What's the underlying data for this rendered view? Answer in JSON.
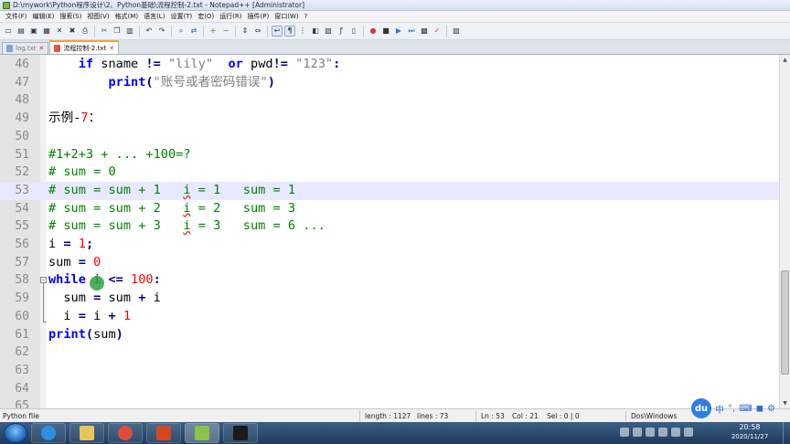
{
  "window": {
    "title": "D:\\mywork\\Python程序设计\\2、Python基础\\流程控制-2.txt - Notepad++ [Administrator]"
  },
  "menu": [
    "文件(F)",
    "编辑(E)",
    "搜索(S)",
    "视图(V)",
    "格式(M)",
    "语言(L)",
    "设置(T)",
    "宏(O)",
    "运行(R)",
    "插件(P)",
    "窗口(W)",
    "?"
  ],
  "toolbar_icons": [
    "new-file-icon",
    "open-file-icon",
    "save-icon",
    "save-all-icon",
    "close-icon",
    "close-all-icon",
    "print-icon",
    "cut-icon",
    "copy-icon",
    "paste-icon",
    "undo-icon",
    "redo-icon",
    "find-icon",
    "replace-icon",
    "zoom-in-icon",
    "zoom-out-icon",
    "sync-v-icon",
    "sync-h-icon",
    "word-wrap-icon",
    "show-all-chars-icon",
    "indent-guide-icon",
    "user-lang-icon",
    "doc-map-icon",
    "function-list-icon",
    "folder-workspace-icon",
    "record-macro-icon",
    "stop-record-icon",
    "play-macro-icon",
    "play-multiple-icon",
    "save-macro-icon",
    "spell-check-icon",
    "doc-switcher-icon"
  ],
  "tabs": [
    {
      "label": "log.txt",
      "active": false
    },
    {
      "label": "流程控制-2.txt",
      "active": true
    }
  ],
  "editor": {
    "lines": [
      {
        "n": "46",
        "t": [
          [
            "    ",
            "plain"
          ],
          [
            "if",
            "kw"
          ],
          [
            " sname ",
            "plain"
          ],
          [
            "!=",
            "op"
          ],
          [
            " ",
            "plain"
          ],
          [
            "\"lily\"",
            "str"
          ],
          [
            "  ",
            "plain"
          ],
          [
            "or",
            "kw"
          ],
          [
            " pwd",
            "plain"
          ],
          [
            "!=",
            "op"
          ],
          [
            " ",
            "plain"
          ],
          [
            "\"123\"",
            "str"
          ],
          [
            ":",
            "op"
          ]
        ]
      },
      {
        "n": "47",
        "t": [
          [
            "        ",
            "plain"
          ],
          [
            "print",
            "kw"
          ],
          [
            "(",
            "op"
          ],
          [
            "\"账号或者密码错误\"",
            "str"
          ],
          [
            ")",
            "op"
          ]
        ]
      },
      {
        "n": "48",
        "t": []
      },
      {
        "n": "49",
        "t": [
          [
            "示例-",
            "plain"
          ],
          [
            "7",
            "num"
          ],
          [
            "：",
            "plain"
          ]
        ]
      },
      {
        "n": "50",
        "t": []
      },
      {
        "n": "51",
        "t": [
          [
            "#1+2+3 + ... +100=?",
            "cmt"
          ]
        ]
      },
      {
        "n": "52",
        "t": [
          [
            "# sum = 0",
            "cmt"
          ]
        ]
      },
      {
        "n": "53",
        "t": [
          [
            "# sum = sum + 1   ",
            "cmt"
          ],
          [
            "i",
            "cmt err"
          ],
          [
            " = 1   sum = 1",
            "cmt"
          ]
        ],
        "current": true
      },
      {
        "n": "54",
        "t": [
          [
            "# sum = sum + 2   ",
            "cmt"
          ],
          [
            "i",
            "cmt err"
          ],
          [
            " = 2   sum = 3",
            "cmt"
          ]
        ]
      },
      {
        "n": "55",
        "t": [
          [
            "# sum = sum + 3   ",
            "cmt"
          ],
          [
            "i",
            "cmt err"
          ],
          [
            " = 3   sum = 6 ...",
            "cmt"
          ]
        ]
      },
      {
        "n": "56",
        "t": [
          [
            "i ",
            "plain"
          ],
          [
            "=",
            "op"
          ],
          [
            " ",
            "plain"
          ],
          [
            "1",
            "num"
          ],
          [
            ";",
            "op"
          ]
        ]
      },
      {
        "n": "57",
        "t": [
          [
            "sum ",
            "plain"
          ],
          [
            "=",
            "op"
          ],
          [
            " ",
            "plain"
          ],
          [
            "0",
            "num"
          ]
        ]
      },
      {
        "n": "58",
        "t": [
          [
            "while",
            "kw"
          ],
          [
            " i ",
            "plain"
          ],
          [
            "<=",
            "op"
          ],
          [
            " ",
            "plain"
          ],
          [
            "100",
            "num"
          ],
          [
            ":",
            "op"
          ]
        ]
      },
      {
        "n": "59",
        "t": [
          [
            "  sum ",
            "plain"
          ],
          [
            "=",
            "op"
          ],
          [
            " sum ",
            "plain"
          ],
          [
            "+",
            "op"
          ],
          [
            " i",
            "plain"
          ]
        ]
      },
      {
        "n": "60",
        "t": [
          [
            "  i ",
            "plain"
          ],
          [
            "=",
            "op"
          ],
          [
            " i ",
            "plain"
          ],
          [
            "+",
            "op"
          ],
          [
            " ",
            "plain"
          ],
          [
            "1",
            "num"
          ]
        ]
      },
      {
        "n": "61",
        "t": [
          [
            "print",
            "kw"
          ],
          [
            "(",
            "op"
          ],
          [
            "sum",
            "plain"
          ],
          [
            ")",
            "op"
          ]
        ]
      },
      {
        "n": "62",
        "t": []
      },
      {
        "n": "63",
        "t": []
      },
      {
        "n": "64",
        "t": []
      },
      {
        "n": "65",
        "t": []
      }
    ]
  },
  "status": {
    "file_type": "Python file",
    "length": "length : 1127",
    "lines": "lines : 73",
    "ln": "Ln : 53",
    "col": "Col : 21",
    "sel": "Sel : 0 | 0",
    "eol": "Dos\\Windows"
  },
  "ime": {
    "logo": "du",
    "mode": "中",
    "punct": "°,"
  },
  "taskbar": {
    "time": "20:58",
    "date": "2020/11/27",
    "apps": [
      "ie-icon",
      "explorer-icon",
      "chrome-icon",
      "powerpoint-icon",
      "notepadpp-icon",
      "pycharm-icon"
    ]
  }
}
